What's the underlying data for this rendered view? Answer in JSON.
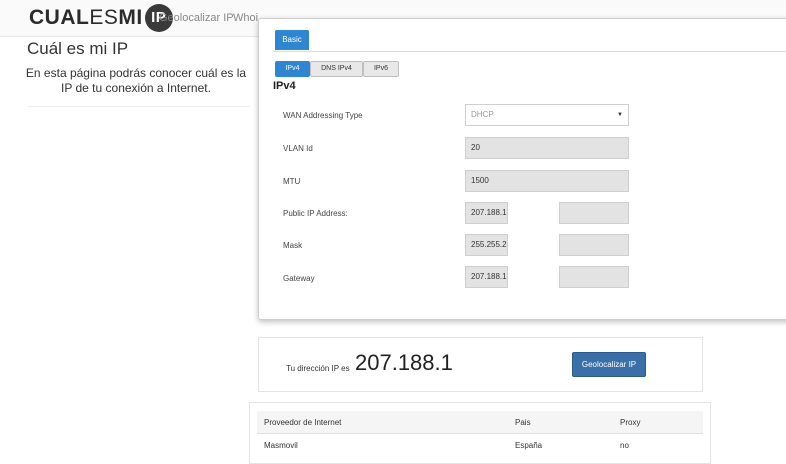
{
  "site": {
    "logo": {
      "cual": "CUAL",
      "es": "ES",
      "mi": "MI",
      "ip": "IP"
    },
    "nav": [
      "Geolocalizar IP",
      "Whoi"
    ],
    "heading": "Cuál es mi IP",
    "description": "En esta página podrás conocer cuál es la IP de tu conexión a Internet."
  },
  "modal": {
    "basic_tab": "Basic",
    "sub_tabs": [
      "IPv4",
      "DNS IPv4",
      "IPv6"
    ],
    "active_sub_tab": "IPv4",
    "section_title": "IPv4",
    "rows": {
      "wan_type": {
        "label": "WAN Addressing Type",
        "value": "DHCP"
      },
      "vlan": {
        "label": "VLAN Id",
        "value": "20"
      },
      "mtu": {
        "label": "MTU",
        "value": "1500"
      },
      "public_ip": {
        "label": "Public IP Address:",
        "value": "207.188.1",
        "value2": ""
      },
      "mask": {
        "label": "Mask",
        "value": "255.255.2",
        "value2": ""
      },
      "gateway": {
        "label": "Gateway",
        "value": "207.188.1",
        "value2": ""
      }
    }
  },
  "ip_card": {
    "label": "Tu dirección IP es",
    "ip": "207.188.1",
    "geo_button": "Geolocalizar IP"
  },
  "isp_table": {
    "headers": [
      "Proveedor de Internet",
      "Pais",
      "Proxy"
    ],
    "rows": [
      [
        "Masmovil",
        "España",
        "no"
      ]
    ]
  },
  "colors": {
    "accent": "#2d86cf",
    "button": "#3b6fa8"
  }
}
